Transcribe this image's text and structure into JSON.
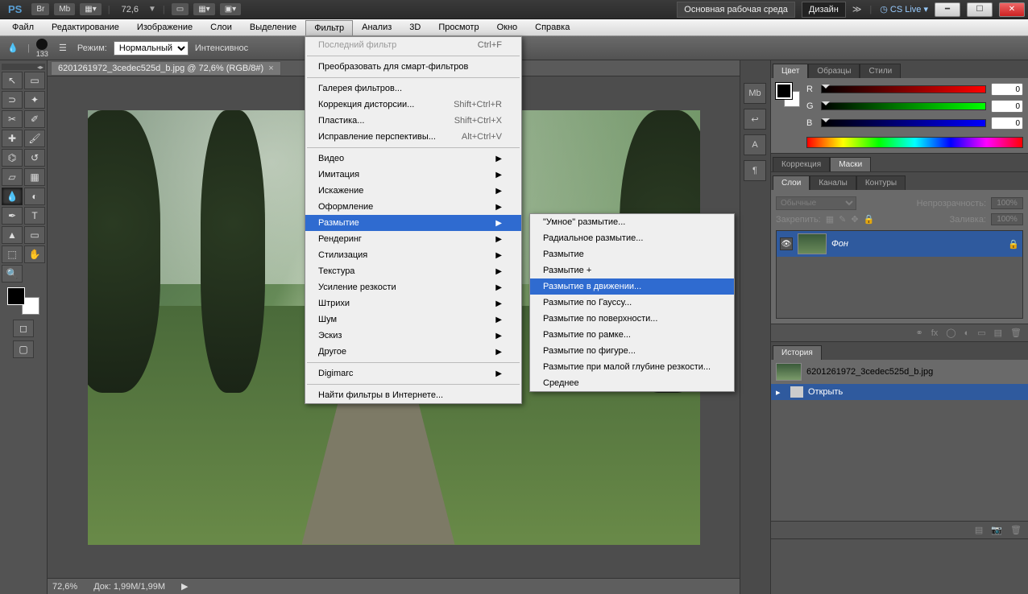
{
  "titlebar": {
    "app": "PS",
    "br": "Br",
    "mb": "Mb",
    "zoom": "72,6",
    "workspace_main": "Основная рабочая среда",
    "workspace_design": "Дизайн",
    "cslive": "CS Live"
  },
  "menubar": [
    "Файл",
    "Редактирование",
    "Изображение",
    "Слои",
    "Выделение",
    "Фильтр",
    "Анализ",
    "3D",
    "Просмотр",
    "Окно",
    "Справка"
  ],
  "menubar_open_index": 5,
  "optionsbar": {
    "brush_size": "133",
    "mode_label": "Режим:",
    "mode_value": "Нормальный",
    "intensity_label": "Интенсивнос"
  },
  "doc": {
    "tab": "6201261972_3cedec525d_b.jpg @ 72,6% (RGB/8#)",
    "status_zoom": "72,6%",
    "status_doc": "Док: 1,99M/1,99M"
  },
  "filter_menu": [
    {
      "label": "Последний фильтр",
      "shortcut": "Ctrl+F",
      "disabled": true
    },
    {
      "sep": true
    },
    {
      "label": "Преобразовать для смарт-фильтров"
    },
    {
      "sep": true
    },
    {
      "label": "Галерея фильтров..."
    },
    {
      "label": "Коррекция дисторсии...",
      "shortcut": "Shift+Ctrl+R"
    },
    {
      "label": "Пластика...",
      "shortcut": "Shift+Ctrl+X"
    },
    {
      "label": "Исправление перспективы...",
      "shortcut": "Alt+Ctrl+V"
    },
    {
      "sep": true
    },
    {
      "label": "Видео",
      "sub": true
    },
    {
      "label": "Имитация",
      "sub": true
    },
    {
      "label": "Искажение",
      "sub": true
    },
    {
      "label": "Оформление",
      "sub": true
    },
    {
      "label": "Размытие",
      "sub": true,
      "highlight": true
    },
    {
      "label": "Рендеринг",
      "sub": true
    },
    {
      "label": "Стилизация",
      "sub": true
    },
    {
      "label": "Текстура",
      "sub": true
    },
    {
      "label": "Усиление резкости",
      "sub": true
    },
    {
      "label": "Штрихи",
      "sub": true
    },
    {
      "label": "Шум",
      "sub": true
    },
    {
      "label": "Эскиз",
      "sub": true
    },
    {
      "label": "Другое",
      "sub": true
    },
    {
      "sep": true
    },
    {
      "label": "Digimarc",
      "sub": true
    },
    {
      "sep": true
    },
    {
      "label": "Найти фильтры в Интернете..."
    }
  ],
  "blur_submenu": [
    {
      "label": "\"Умное\" размытие..."
    },
    {
      "label": "Радиальное размытие..."
    },
    {
      "label": "Размытие"
    },
    {
      "label": "Размытие +"
    },
    {
      "label": "Размытие в движении...",
      "highlight": true
    },
    {
      "label": "Размытие по Гауссу..."
    },
    {
      "label": "Размытие по поверхности..."
    },
    {
      "label": "Размытие по рамке..."
    },
    {
      "label": "Размытие по фигуре..."
    },
    {
      "label": "Размытие при малой глубине резкости..."
    },
    {
      "label": "Среднее"
    }
  ],
  "tools": [
    [
      "move",
      "marquee"
    ],
    [
      "lasso",
      "wand"
    ],
    [
      "crop",
      "eyedropper"
    ],
    [
      "heal",
      "brush"
    ],
    [
      "stamp",
      "history-brush"
    ],
    [
      "eraser",
      "gradient"
    ],
    [
      "blur",
      "dodge"
    ],
    [
      "pen",
      "type"
    ],
    [
      "path-select",
      "shape"
    ],
    [
      "3d",
      "hand"
    ],
    [
      "zoom",
      ""
    ]
  ],
  "active_tool": "blur",
  "panel_tabs": {
    "color": [
      "Цвет",
      "Образцы",
      "Стили"
    ],
    "adjust": [
      "Коррекция",
      "Маски"
    ],
    "layers": [
      "Слои",
      "Каналы",
      "Контуры"
    ],
    "history": [
      "История"
    ]
  },
  "color": {
    "r": "0",
    "g": "0",
    "b": "0"
  },
  "layers": {
    "blend_value": "Обычные",
    "opacity_label": "Непрозрачность:",
    "opacity_value": "100%",
    "lock_label": "Закрепить:",
    "fill_label": "Заливка:",
    "fill_value": "100%",
    "layer_name": "Фон"
  },
  "history": {
    "doc_name": "6201261972_3cedec525d_b.jpg",
    "step": "Открыть"
  }
}
